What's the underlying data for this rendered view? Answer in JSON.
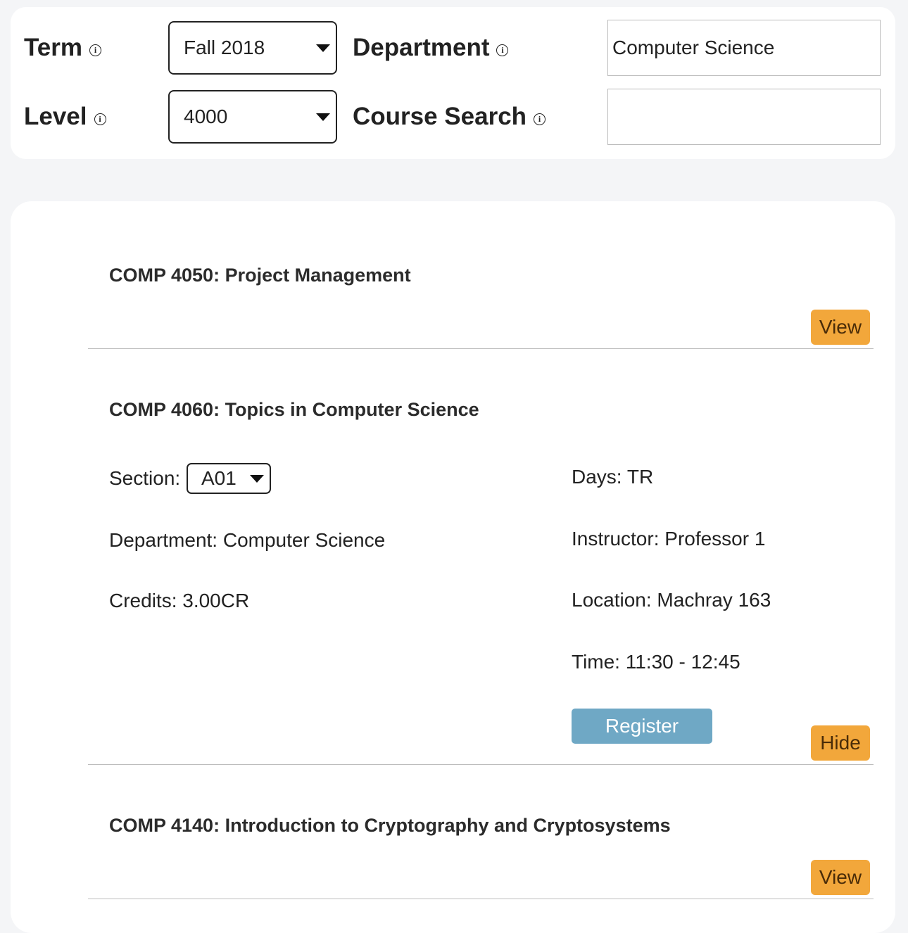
{
  "filters": {
    "term_label": "Term",
    "term_value": "Fall 2018",
    "level_label": "Level",
    "level_value": "4000",
    "department_label": "Department",
    "department_value": "Computer Science",
    "course_search_label": "Course Search",
    "course_search_value": "",
    "info_glyph": "i"
  },
  "courses": [
    {
      "title": "COMP 4050: Project Management",
      "action": "View"
    },
    {
      "title": "COMP 4060: Topics in Computer Science",
      "action": "Hide",
      "section_label": "Section:",
      "section_value": "A01",
      "department": "Department: Computer Science",
      "credits": "Credits: 3.00CR",
      "days": "Days: TR",
      "instructor": "Instructor: Professor 1",
      "location": "Location: Machray 163",
      "time": "Time: 11:30 - 12:45",
      "register": "Register"
    },
    {
      "title": "COMP 4140: Introduction to Cryptography and Cryptosystems",
      "action": "View"
    }
  ],
  "colors": {
    "page_bg": "#f4f5f7",
    "action_button": "#f2a73b",
    "register_button": "#6fa8c5"
  },
  "icons": [
    "info-icon",
    "dropdown-caret-icon"
  ]
}
